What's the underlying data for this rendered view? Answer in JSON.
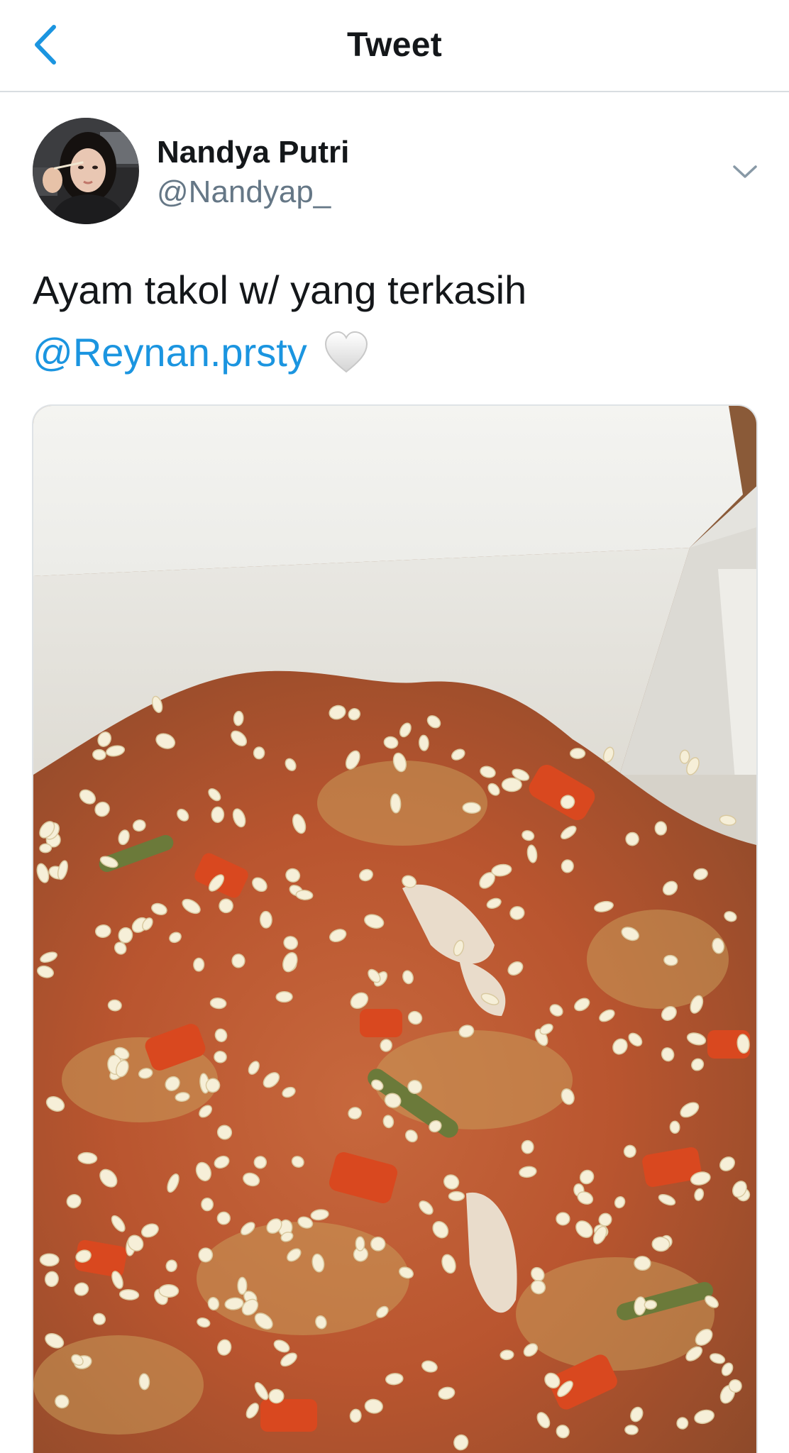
{
  "header": {
    "title": "Tweet",
    "back_icon": "chevron-left-icon",
    "accent_color": "#1b95e0"
  },
  "tweet": {
    "author": {
      "display_name": "Nandya Putri",
      "handle": "@Nandyap_"
    },
    "more_icon": "chevron-down-icon",
    "text": "Ayam takol w/ yang terkasih",
    "mention": "@Reynan.prsty",
    "emoji": "white-heart",
    "media_description_icon": "photo-food-icon"
  },
  "colors": {
    "text_primary": "#14171a",
    "text_secondary": "#657786",
    "link": "#1b95e0",
    "divider": "#d9dde1"
  }
}
